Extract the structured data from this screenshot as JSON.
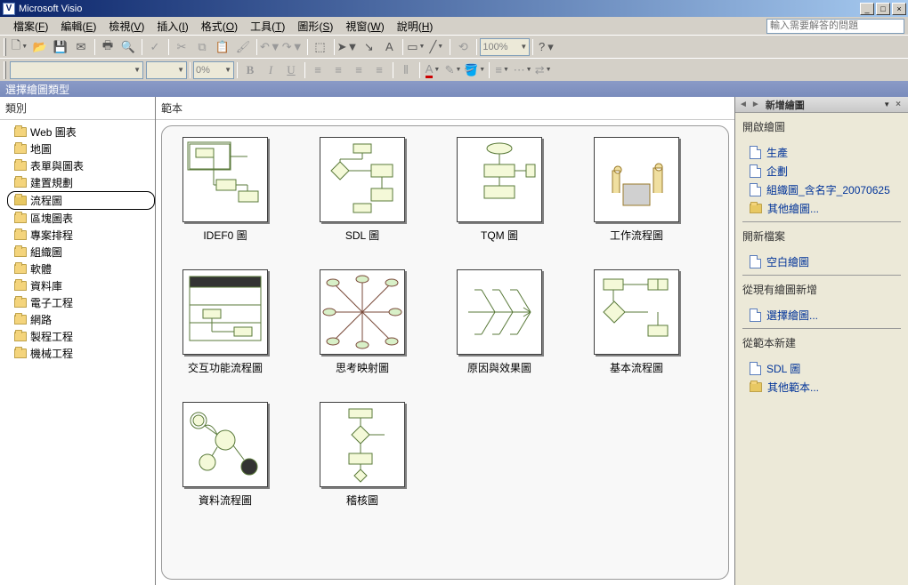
{
  "app": {
    "title": "Microsoft Visio"
  },
  "winbuttons": {
    "min": "_",
    "max": "□",
    "close": "×"
  },
  "menu": [
    {
      "label": "檔案",
      "key": "F"
    },
    {
      "label": "編輯",
      "key": "E"
    },
    {
      "label": "檢視",
      "key": "V"
    },
    {
      "label": "插入",
      "key": "I"
    },
    {
      "label": "格式",
      "key": "O"
    },
    {
      "label": "工具",
      "key": "T"
    },
    {
      "label": "圖形",
      "key": "S"
    },
    {
      "label": "視窗",
      "key": "W"
    },
    {
      "label": "說明",
      "key": "H"
    }
  ],
  "helpbox_placeholder": "輸入需要解答的問題",
  "toolbar2": {
    "zoom": "100%",
    "font_combo": "",
    "size_combo": "",
    "bold": "B",
    "italic": "I",
    "underline": "U",
    "percent": "0%"
  },
  "panel_header": "選擇繪圖類型",
  "left": {
    "header": "類別",
    "items": [
      {
        "label": "Web 圖表"
      },
      {
        "label": "地圖"
      },
      {
        "label": "表單與圖表"
      },
      {
        "label": "建置規劃"
      },
      {
        "label": "流程圖",
        "selected": true
      },
      {
        "label": "區塊圖表"
      },
      {
        "label": "專案排程"
      },
      {
        "label": "組織圖"
      },
      {
        "label": "軟體"
      },
      {
        "label": "資料庫"
      },
      {
        "label": "電子工程"
      },
      {
        "label": "網路"
      },
      {
        "label": "製程工程"
      },
      {
        "label": "機械工程"
      }
    ]
  },
  "center": {
    "header": "範本",
    "templates": [
      {
        "label": "IDEF0 圖",
        "kind": "idef0"
      },
      {
        "label": "SDL 圖",
        "kind": "sdl"
      },
      {
        "label": "TQM 圖",
        "kind": "tqm"
      },
      {
        "label": "工作流程圖",
        "kind": "work"
      },
      {
        "label": "交互功能流程圖",
        "kind": "cross"
      },
      {
        "label": "思考映射圖",
        "kind": "mind"
      },
      {
        "label": "原因與效果圖",
        "kind": "fish"
      },
      {
        "label": "基本流程圖",
        "kind": "basic"
      },
      {
        "label": "資料流程圖",
        "kind": "dfd"
      },
      {
        "label": "稽核圖",
        "kind": "audit"
      }
    ]
  },
  "right": {
    "title": "新增繪圖",
    "sections": {
      "open": {
        "title": "開啟繪圖",
        "items": [
          {
            "label": "生產",
            "icon": "doc"
          },
          {
            "label": "企劃",
            "icon": "doc"
          },
          {
            "label": "組織圖_含名字_20070625",
            "icon": "doc"
          },
          {
            "label": "其他繪圖...",
            "icon": "folder"
          }
        ]
      },
      "new": {
        "title": "開新檔案",
        "items": [
          {
            "label": "空白繪圖",
            "icon": "blank"
          }
        ]
      },
      "fromexisting": {
        "title": "從現有繪圖新增",
        "items": [
          {
            "label": "選擇繪圖...",
            "icon": "doc"
          }
        ]
      },
      "fromtemplate": {
        "title": "從範本新建",
        "items": [
          {
            "label": "SDL 圖",
            "icon": "doc"
          },
          {
            "label": "其他範本...",
            "icon": "folder"
          }
        ]
      }
    }
  }
}
